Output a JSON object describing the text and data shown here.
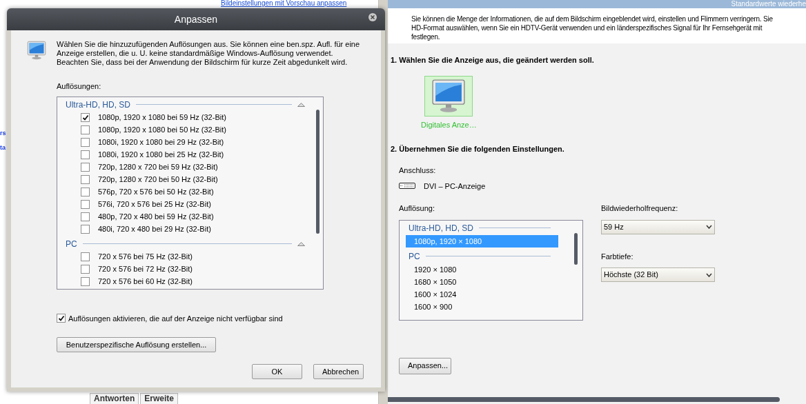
{
  "background": {
    "top_link": "Bildeinstellungen mit Vorschau anpassen",
    "left_fragments": [
      "rs",
      "ta"
    ],
    "bottom_tabs": [
      {
        "label": "Antworten"
      },
      {
        "label": "Erweite"
      }
    ]
  },
  "panel": {
    "header": "Standardwerte wiederhe",
    "intro": [
      "Sie können die Menge der Informationen, die auf dem Bildschirm eingeblendet wird, einstellen und Flimmern verringern. Sie",
      "HD-Format auswählen, wenn Sie ein HDTV-Gerät verwenden und ein länderspezifisches Signal für Ihr Fernsehgerät mit",
      "festlegen."
    ],
    "step1": "1. Wählen Sie die Anzeige aus, die geändert werden soll.",
    "displays": [
      {
        "label": "Digitales Anze…",
        "selected": true
      }
    ],
    "step2": "2. Übernehmen Sie die folgenden Einstellungen.",
    "connection_label": "Anschluss:",
    "connection": "DVI – PC-Anzeige",
    "resolution_label": "Auflösung:",
    "resolution_groups": [
      {
        "title": "Ultra-HD, HD, SD",
        "items": [
          {
            "label": "1080p, 1920 × 1080",
            "selected": true
          }
        ]
      },
      {
        "title": "PC",
        "items": [
          {
            "label": "1920 × 1080",
            "selected": false
          },
          {
            "label": "1680 × 1050",
            "selected": false
          },
          {
            "label": "1600 × 1024",
            "selected": false
          },
          {
            "label": "1600 × 900",
            "selected": false
          }
        ]
      }
    ],
    "refresh_label": "Bildwiederholfrequenz:",
    "refresh_value": "59 Hz",
    "depth_label": "Farbtiefe:",
    "depth_value": "Höchste (32 Bit)",
    "customize_button": "Anpassen..."
  },
  "dialog": {
    "title": "Anpassen",
    "description": "Wählen Sie die hinzuzufügenden Auflösungen aus. Sie können eine ben.spz. Aufl. für eine Anzeige erstellen, die u. U. keine standardmäßige Windows-Auflösung verwendet. Beachten Sie, dass bei der Anwendung der Bildschirm für kurze Zeit abgedunkelt wird.",
    "list_label": "Auflösungen:",
    "groups": [
      {
        "title": "Ultra-HD, HD, SD",
        "expanded": true,
        "items": [
          {
            "label": "1080p, 1920 x 1080 bei 59 Hz (32-Bit)",
            "checked": true
          },
          {
            "label": "1080p, 1920 x 1080 bei 50 Hz (32-Bit)",
            "checked": false
          },
          {
            "label": "1080i, 1920 x 1080 bei 29 Hz (32-Bit)",
            "checked": false
          },
          {
            "label": "1080i, 1920 x 1080 bei 25 Hz (32-Bit)",
            "checked": false
          },
          {
            "label": "720p, 1280 x 720 bei 59 Hz (32-Bit)",
            "checked": false
          },
          {
            "label": "720p, 1280 x 720 bei 50 Hz (32-Bit)",
            "checked": false
          },
          {
            "label": "576p, 720 x 576 bei 50 Hz (32-Bit)",
            "checked": false
          },
          {
            "label": "576i, 720 x 576 bei 25 Hz (32-Bit)",
            "checked": false
          },
          {
            "label": "480p, 720 x 480 bei 59 Hz (32-Bit)",
            "checked": false
          },
          {
            "label": "480i, 720 x 480 bei 29 Hz (32-Bit)",
            "checked": false
          }
        ]
      },
      {
        "title": "PC",
        "expanded": true,
        "items": [
          {
            "label": "720 x 576 bei 75 Hz (32-Bit)",
            "checked": false
          },
          {
            "label": "720 x 576 bei 72 Hz (32-Bit)",
            "checked": false
          },
          {
            "label": "720 x 576 bei 60 Hz (32-Bit)",
            "checked": false
          }
        ]
      }
    ],
    "enable_unavailable": {
      "label": "Auflösungen aktivieren, die auf der Anzeige nicht verfügbar sind",
      "checked": true
    },
    "custom_button": "Benutzerspezifische Auflösung erstellen...",
    "buttons": [
      "OK",
      "Abbrechen"
    ]
  }
}
